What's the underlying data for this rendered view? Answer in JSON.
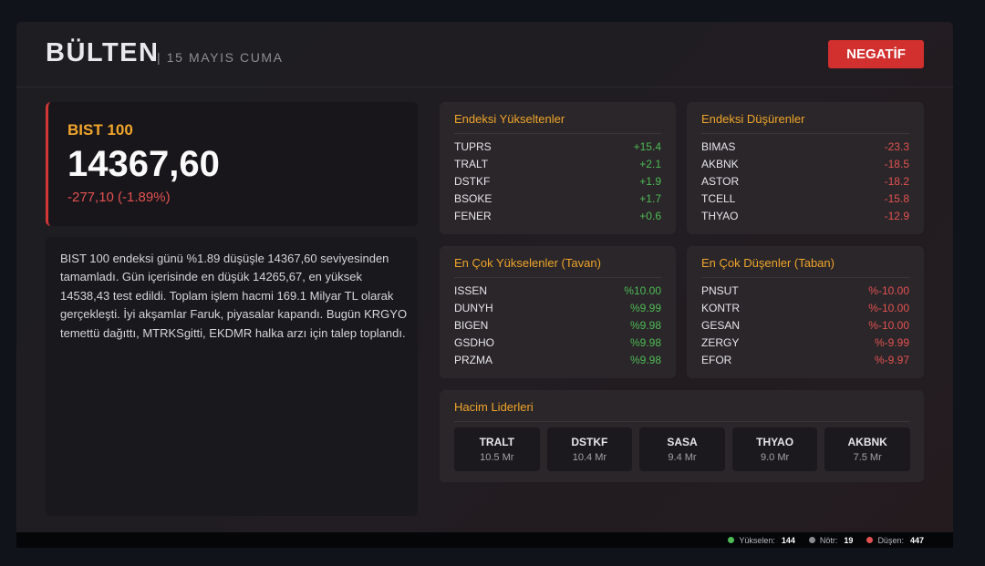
{
  "header": {
    "title": "BÜLTEN",
    "date": "| 15 MAYIS CUMA",
    "sentiment": "NEGATİF"
  },
  "index": {
    "name": "BIST 100",
    "value": "14367,60",
    "change": "-277,10 (-1.89%)"
  },
  "summary": "BIST 100 endeksi günü %1.89 düşüşle 14367,60 seviyesinden tamamladı. Gün içerisinde en düşük 14265,67, en yüksek 14538,43 test edildi. Toplam işlem hacmi 169.1 Milyar TL olarak gerçekleşti. İyi akşamlar Faruk, piyasalar kapandı. Bugün KRGYO temettü dağıttı, MTRKSgitti, EKDMR halka arzı için talep toplandı.",
  "panels": {
    "gainers": {
      "title": "Endeksi Yükseltenler",
      "rows": [
        {
          "symbol": "TUPRS",
          "value": "+15.4"
        },
        {
          "symbol": "TRALT",
          "value": "+2.1"
        },
        {
          "symbol": "DSTKF",
          "value": "+1.9"
        },
        {
          "symbol": "BSOKE",
          "value": "+1.7"
        },
        {
          "symbol": "FENER",
          "value": "+0.6"
        }
      ]
    },
    "losers": {
      "title": "Endeksi Düşürenler",
      "rows": [
        {
          "symbol": "BIMAS",
          "value": "-23.3"
        },
        {
          "symbol": "AKBNK",
          "value": "-18.5"
        },
        {
          "symbol": "ASTOR",
          "value": "-18.2"
        },
        {
          "symbol": "TCELL",
          "value": "-15.8"
        },
        {
          "symbol": "THYAO",
          "value": "-12.9"
        }
      ]
    },
    "ceiling": {
      "title": "En Çok Yükselenler (Tavan)",
      "rows": [
        {
          "symbol": "ISSEN",
          "value": "%10.00"
        },
        {
          "symbol": "DUNYH",
          "value": "%9.99"
        },
        {
          "symbol": "BIGEN",
          "value": "%9.98"
        },
        {
          "symbol": "GSDHO",
          "value": "%9.98"
        },
        {
          "symbol": "PRZMA",
          "value": "%9.98"
        }
      ]
    },
    "floor": {
      "title": "En Çok Düşenler (Taban)",
      "rows": [
        {
          "symbol": "PNSUT",
          "value": "%-10.00"
        },
        {
          "symbol": "KONTR",
          "value": "%-10.00"
        },
        {
          "symbol": "GESAN",
          "value": "%-10.00"
        },
        {
          "symbol": "ZERGY",
          "value": "%-9.99"
        },
        {
          "symbol": "EFOR",
          "value": "%-9.97"
        }
      ]
    },
    "volume": {
      "title": "Hacim Liderleri",
      "items": [
        {
          "symbol": "TRALT",
          "amount": "10.5 Mr"
        },
        {
          "symbol": "DSTKF",
          "amount": "10.4 Mr"
        },
        {
          "symbol": "SASA",
          "amount": "9.4 Mr"
        },
        {
          "symbol": "THYAO",
          "amount": "9.0 Mr"
        },
        {
          "symbol": "AKBNK",
          "amount": "7.5 Mr"
        }
      ]
    }
  },
  "footer": {
    "rising": {
      "label": "Yükselen:",
      "count": "144",
      "color": "#4fbb56"
    },
    "neutral": {
      "label": "Nötr:",
      "count": "19",
      "color": "#8b8b90"
    },
    "falling": {
      "label": "Düşen:",
      "count": "447",
      "color": "#e35252"
    }
  },
  "colors": {
    "accent": "#f0a52b",
    "up": "#4fbb56",
    "down": "#e35252",
    "badge": "#d22f2f"
  }
}
